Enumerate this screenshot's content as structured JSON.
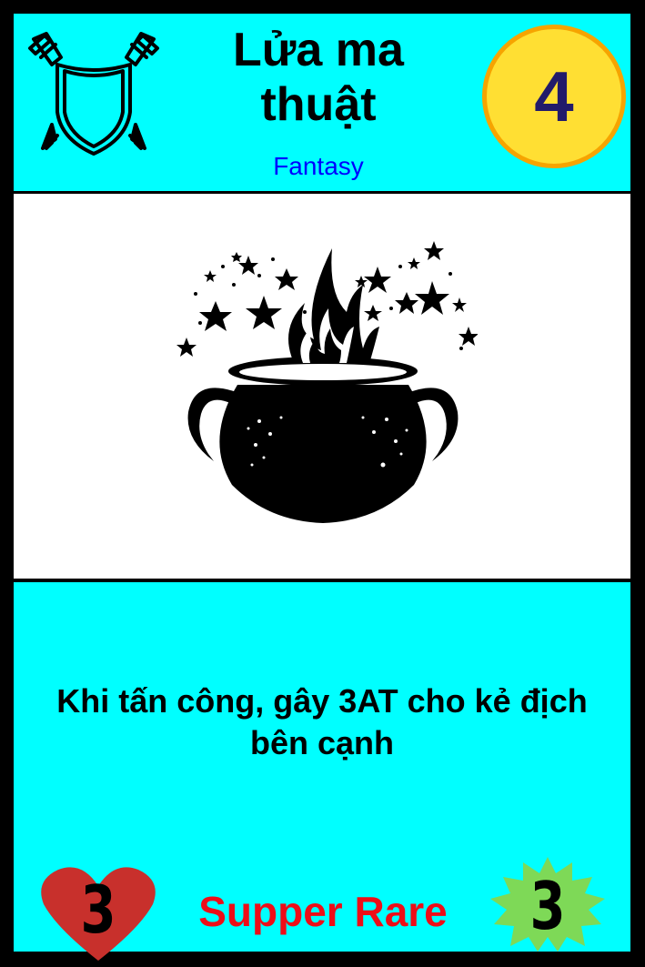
{
  "card": {
    "title": "Lửa ma thuật",
    "category": "Fantasy",
    "cost": "4",
    "type_icon": "crossed-swords-shield-icon",
    "art": "magic-cauldron-image",
    "ability_text": "Khi tấn công, gây 3AT cho kẻ địch bên cạnh",
    "health": "3",
    "rarity": "Supper Rare",
    "attack": "3"
  },
  "colors": {
    "frame": "#000000",
    "panel": "#00ffff",
    "art_bg": "#ffffff",
    "category_text": "#0000ff",
    "cost_fill": "#ffdf33",
    "cost_border": "#f6a400",
    "cost_text": "#221b6a",
    "heart": "#c8302c",
    "starburst": "#7ed957",
    "rarity_text": "#ee0d17"
  }
}
